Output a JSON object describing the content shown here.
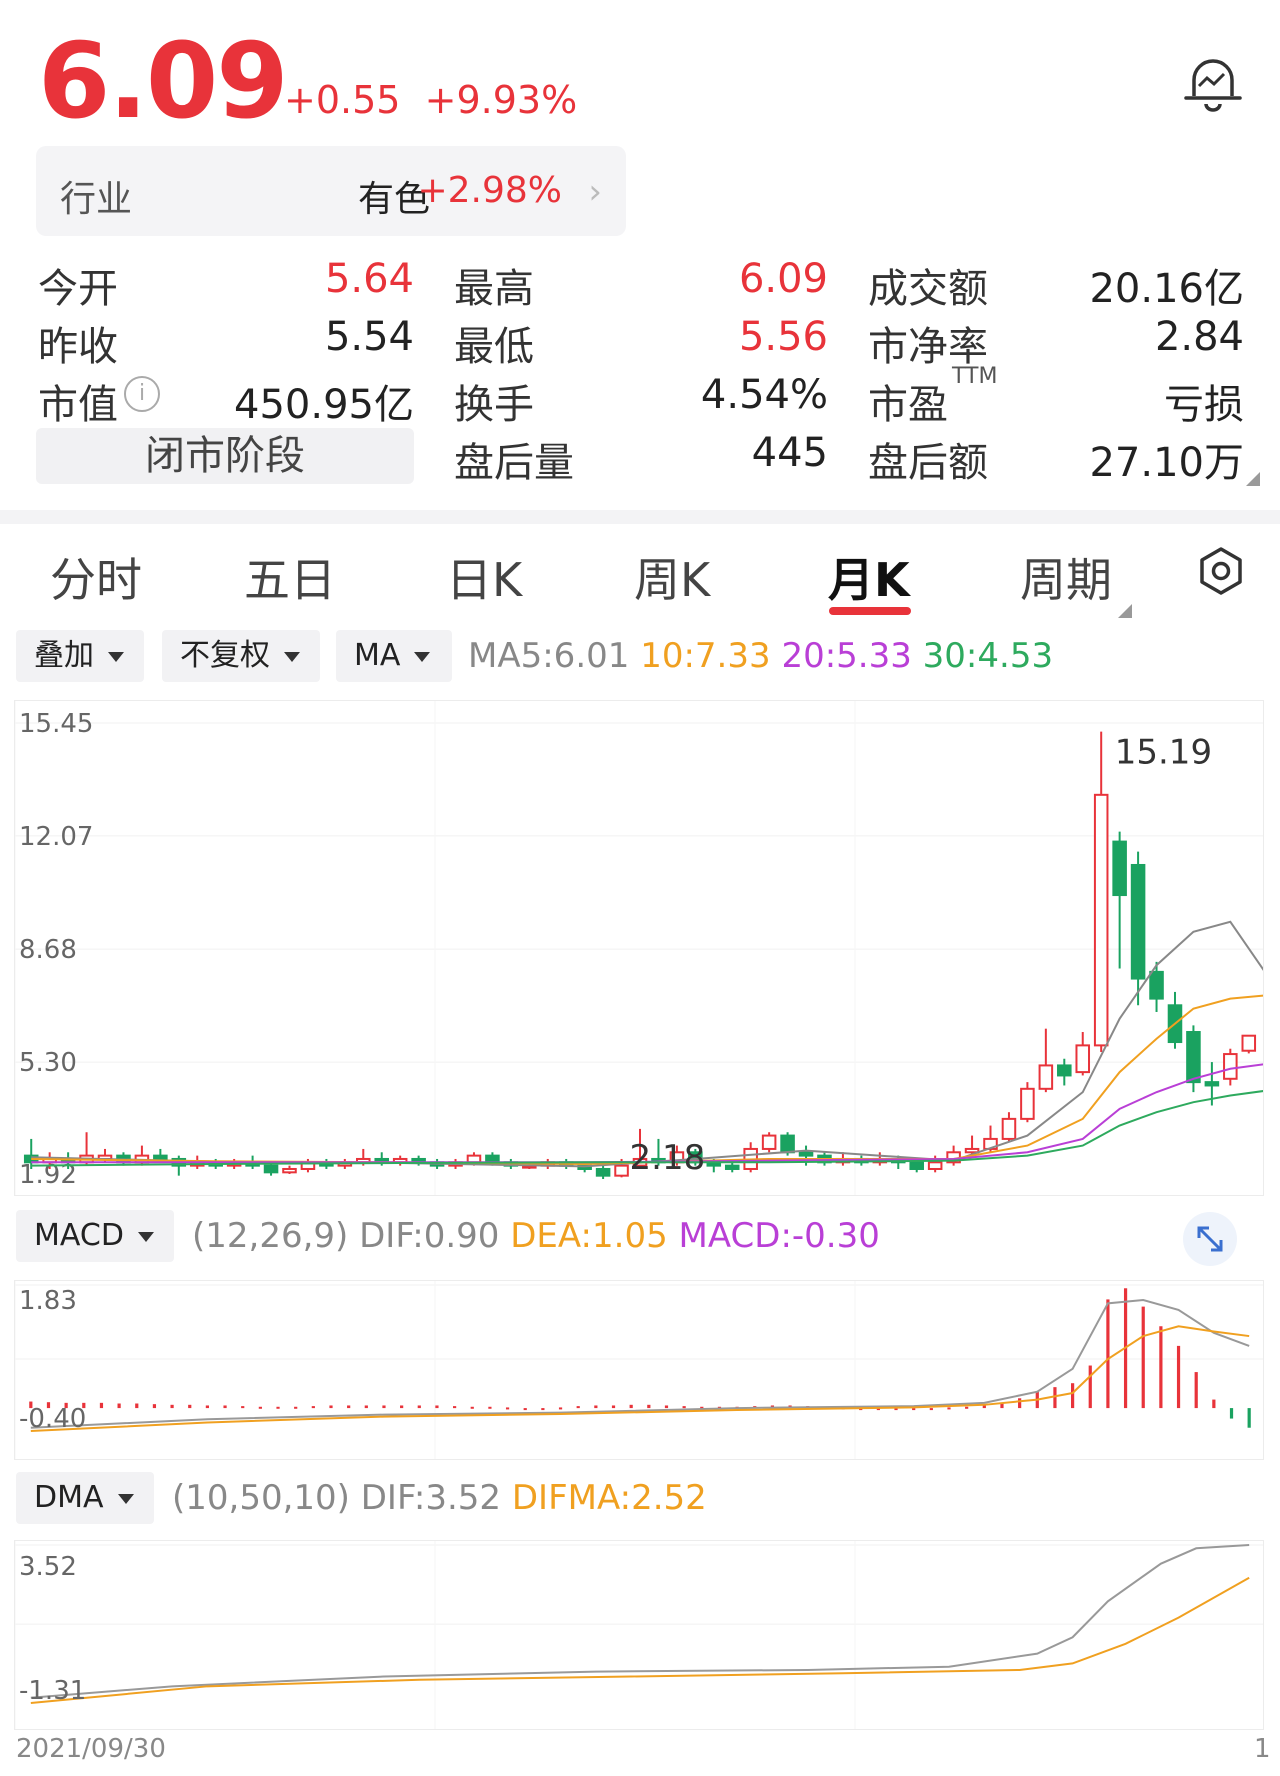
{
  "quote": {
    "price": "6.09",
    "change": "+0.55",
    "change_pct": "+9.93%",
    "industry_label": "行业",
    "industry_name": "有色",
    "industry_pct": "+2.98%",
    "status": "闭市阶段"
  },
  "stats": [
    {
      "label": "今开",
      "value": "5.64",
      "color": "#e8333a"
    },
    {
      "label": "最高",
      "value": "6.09",
      "color": "#e8333a"
    },
    {
      "label": "成交额",
      "value": "20.16亿",
      "color": "#222222"
    },
    {
      "label": "昨收",
      "value": "5.54",
      "color": "#222222"
    },
    {
      "label": "最低",
      "value": "5.56",
      "color": "#e8333a"
    },
    {
      "label": "市净率",
      "value": "2.84",
      "color": "#222222"
    },
    {
      "label": "市值",
      "value": "450.95亿",
      "color": "#222222"
    },
    {
      "label": "换手",
      "value": "4.54%",
      "color": "#222222"
    },
    {
      "label": "市盈",
      "sup": "TTM",
      "value": "亏损",
      "color": "#222222"
    },
    {
      "label": "盘后量",
      "value": "445",
      "color": "#222222"
    },
    {
      "label": "盘后额",
      "value": "27.10万",
      "color": "#222222"
    }
  ],
  "tabs": [
    "分时",
    "五日",
    "日K",
    "周K",
    "月K",
    "周期"
  ],
  "active_tab": "月K",
  "toolbar": {
    "overlay": "叠加",
    "adjust": "不复权",
    "indicator": "MA",
    "ma5": "MA5:6.01",
    "ma10": "10:7.33",
    "ma20": "20:5.33",
    "ma30": "30:4.53"
  },
  "macd_bar": {
    "name": "MACD",
    "params": "(12,26,9)",
    "dif": "DIF:0.90",
    "dea": "DEA:1.05",
    "macd": "MACD:-0.30"
  },
  "dma_bar": {
    "name": "DMA",
    "params": "(10,50,10)",
    "dif": "DIF:3.52",
    "difma": "DIFMA:2.52"
  },
  "dates": {
    "left": "2021/09/30",
    "right": "1"
  },
  "colors": {
    "up": "#e8333a",
    "down": "#1aa260",
    "ma5": "#888888",
    "ma10": "#f0a020",
    "ma20": "#b93fd6",
    "ma30": "#2eaa5e"
  },
  "chart_data": [
    {
      "type": "candlestick",
      "axis_labels": [
        "15.45",
        "12.07",
        "8.68",
        "5.30",
        "1.92"
      ],
      "ylim": [
        1.92,
        15.45
      ],
      "max_label": "15.19",
      "min_label": "2.18",
      "legend": [
        "MA5",
        "10",
        "20",
        "30"
      ],
      "candles": [
        {
          "o": 2.5,
          "c": 2.3,
          "h": 3.0,
          "l": 2.1
        },
        {
          "o": 2.3,
          "c": 2.4,
          "h": 2.6,
          "l": 2.1
        },
        {
          "o": 2.4,
          "c": 2.3,
          "h": 2.6,
          "l": 2.1
        },
        {
          "o": 2.3,
          "c": 2.5,
          "h": 3.2,
          "l": 2.2
        },
        {
          "o": 2.4,
          "c": 2.5,
          "h": 2.7,
          "l": 2.3
        },
        {
          "o": 2.5,
          "c": 2.3,
          "h": 2.6,
          "l": 2.2
        },
        {
          "o": 2.3,
          "c": 2.5,
          "h": 2.8,
          "l": 2.2
        },
        {
          "o": 2.5,
          "c": 2.4,
          "h": 2.7,
          "l": 2.3
        },
        {
          "o": 2.4,
          "c": 2.2,
          "h": 2.5,
          "l": 1.9
        },
        {
          "o": 2.2,
          "c": 2.3,
          "h": 2.5,
          "l": 2.1
        },
        {
          "o": 2.3,
          "c": 2.2,
          "h": 2.4,
          "l": 2.1
        },
        {
          "o": 2.2,
          "c": 2.3,
          "h": 2.4,
          "l": 2.1
        },
        {
          "o": 2.3,
          "c": 2.2,
          "h": 2.5,
          "l": 2.1
        },
        {
          "o": 2.2,
          "c": 2.0,
          "h": 2.3,
          "l": 1.9
        },
        {
          "o": 2.0,
          "c": 2.1,
          "h": 2.2,
          "l": 1.95
        },
        {
          "o": 2.1,
          "c": 2.3,
          "h": 2.4,
          "l": 2.0
        },
        {
          "o": 2.3,
          "c": 2.2,
          "h": 2.4,
          "l": 2.1
        },
        {
          "o": 2.2,
          "c": 2.3,
          "h": 2.4,
          "l": 2.1
        },
        {
          "o": 2.3,
          "c": 2.4,
          "h": 2.7,
          "l": 2.2
        },
        {
          "o": 2.4,
          "c": 2.3,
          "h": 2.6,
          "l": 2.2
        },
        {
          "o": 2.3,
          "c": 2.4,
          "h": 2.5,
          "l": 2.2
        },
        {
          "o": 2.4,
          "c": 2.3,
          "h": 2.5,
          "l": 2.2
        },
        {
          "o": 2.3,
          "c": 2.2,
          "h": 2.4,
          "l": 2.1
        },
        {
          "o": 2.2,
          "c": 2.3,
          "h": 2.4,
          "l": 2.1
        },
        {
          "o": 2.3,
          "c": 2.5,
          "h": 2.6,
          "l": 2.2
        },
        {
          "o": 2.5,
          "c": 2.3,
          "h": 2.6,
          "l": 2.2
        },
        {
          "o": 2.3,
          "c": 2.2,
          "h": 2.4,
          "l": 2.1
        },
        {
          "o": 2.2,
          "c": 2.2,
          "h": 2.3,
          "l": 2.1
        },
        {
          "o": 2.2,
          "c": 2.3,
          "h": 2.4,
          "l": 2.1
        },
        {
          "o": 2.3,
          "c": 2.2,
          "h": 2.4,
          "l": 2.1
        },
        {
          "o": 2.2,
          "c": 2.1,
          "h": 2.3,
          "l": 2.0
        },
        {
          "o": 2.1,
          "c": 1.9,
          "h": 2.2,
          "l": 1.8
        },
        {
          "o": 1.9,
          "c": 2.2,
          "h": 2.4,
          "l": 1.85
        },
        {
          "o": 2.2,
          "c": 2.4,
          "h": 3.3,
          "l": 2.1
        },
        {
          "o": 2.4,
          "c": 2.3,
          "h": 3.0,
          "l": 2.2
        },
        {
          "o": 2.3,
          "c": 2.6,
          "h": 2.8,
          "l": 2.2
        },
        {
          "o": 2.6,
          "c": 2.3,
          "h": 2.7,
          "l": 2.2
        },
        {
          "o": 2.3,
          "c": 2.2,
          "h": 2.4,
          "l": 2.0
        },
        {
          "o": 2.2,
          "c": 2.1,
          "h": 2.3,
          "l": 2.0
        },
        {
          "o": 2.1,
          "c": 2.7,
          "h": 2.9,
          "l": 2.0
        },
        {
          "o": 2.7,
          "c": 3.1,
          "h": 3.2,
          "l": 2.6
        },
        {
          "o": 3.1,
          "c": 2.6,
          "h": 3.2,
          "l": 2.5
        },
        {
          "o": 2.6,
          "c": 2.5,
          "h": 2.8,
          "l": 2.2
        },
        {
          "o": 2.5,
          "c": 2.3,
          "h": 2.6,
          "l": 2.2
        },
        {
          "o": 2.3,
          "c": 2.4,
          "h": 2.6,
          "l": 2.2
        },
        {
          "o": 2.4,
          "c": 2.3,
          "h": 2.5,
          "l": 2.2
        },
        {
          "o": 2.3,
          "c": 2.4,
          "h": 2.6,
          "l": 2.2
        },
        {
          "o": 2.4,
          "c": 2.3,
          "h": 2.5,
          "l": 2.1
        },
        {
          "o": 2.3,
          "c": 2.1,
          "h": 2.4,
          "l": 2.0
        },
        {
          "o": 2.1,
          "c": 2.3,
          "h": 2.5,
          "l": 2.0
        },
        {
          "o": 2.3,
          "c": 2.6,
          "h": 2.8,
          "l": 2.2
        },
        {
          "o": 2.6,
          "c": 2.7,
          "h": 3.1,
          "l": 2.5
        },
        {
          "o": 2.7,
          "c": 3.0,
          "h": 3.4,
          "l": 2.6
        },
        {
          "o": 3.0,
          "c": 3.6,
          "h": 3.8,
          "l": 2.9
        },
        {
          "o": 3.6,
          "c": 4.5,
          "h": 4.7,
          "l": 3.5
        },
        {
          "o": 4.5,
          "c": 5.2,
          "h": 6.3,
          "l": 4.4
        },
        {
          "o": 5.2,
          "c": 4.9,
          "h": 5.4,
          "l": 4.6
        },
        {
          "o": 5.0,
          "c": 5.8,
          "h": 6.2,
          "l": 4.9
        },
        {
          "o": 5.8,
          "c": 13.3,
          "h": 15.19,
          "l": 5.6
        },
        {
          "o": 11.9,
          "c": 10.3,
          "h": 12.2,
          "l": 8.1
        },
        {
          "o": 11.2,
          "c": 7.8,
          "h": 11.6,
          "l": 7.0
        },
        {
          "o": 8.0,
          "c": 7.2,
          "h": 8.3,
          "l": 6.8
        },
        {
          "o": 7.0,
          "c": 5.9,
          "h": 7.4,
          "l": 5.7
        },
        {
          "o": 6.2,
          "c": 4.7,
          "h": 6.4,
          "l": 4.4
        },
        {
          "o": 4.7,
          "c": 4.6,
          "h": 5.3,
          "l": 4.0
        },
        {
          "o": 4.8,
          "c": 5.54,
          "h": 5.7,
          "l": 4.6
        },
        {
          "o": 5.64,
          "c": 6.09,
          "h": 6.09,
          "l": 5.56
        }
      ],
      "ma_series": [
        {
          "name": "MA5",
          "values": [
            [
              0,
              2.45
            ],
            [
              10,
              2.32
            ],
            [
              20,
              2.28
            ],
            [
              30,
              2.18
            ],
            [
              36,
              2.4
            ],
            [
              42,
              2.65
            ],
            [
              50,
              2.35
            ],
            [
              54,
              3.1
            ],
            [
              57,
              4.4
            ],
            [
              59,
              6.6
            ],
            [
              61,
              8.2
            ],
            [
              63,
              9.2
            ],
            [
              65,
              9.5
            ],
            [
              67,
              7.9
            ],
            [
              69,
              6.01
            ]
          ]
        },
        {
          "name": "10",
          "values": [
            [
              0,
              2.4
            ],
            [
              10,
              2.33
            ],
            [
              20,
              2.3
            ],
            [
              30,
              2.25
            ],
            [
              40,
              2.4
            ],
            [
              50,
              2.4
            ],
            [
              54,
              2.8
            ],
            [
              57,
              3.6
            ],
            [
              59,
              5.0
            ],
            [
              61,
              6.0
            ],
            [
              63,
              6.9
            ],
            [
              65,
              7.2
            ],
            [
              67,
              7.3
            ],
            [
              69,
              7.33
            ]
          ]
        },
        {
          "name": "20",
          "values": [
            [
              0,
              2.3
            ],
            [
              10,
              2.3
            ],
            [
              20,
              2.3
            ],
            [
              30,
              2.3
            ],
            [
              40,
              2.35
            ],
            [
              50,
              2.4
            ],
            [
              54,
              2.6
            ],
            [
              57,
              3.0
            ],
            [
              59,
              3.9
            ],
            [
              61,
              4.4
            ],
            [
              63,
              4.8
            ],
            [
              65,
              5.1
            ],
            [
              67,
              5.25
            ],
            [
              69,
              5.33
            ]
          ]
        },
        {
          "name": "30",
          "values": [
            [
              0,
              2.2
            ],
            [
              10,
              2.25
            ],
            [
              20,
              2.28
            ],
            [
              30,
              2.3
            ],
            [
              40,
              2.3
            ],
            [
              50,
              2.35
            ],
            [
              54,
              2.5
            ],
            [
              57,
              2.8
            ],
            [
              59,
              3.4
            ],
            [
              61,
              3.8
            ],
            [
              63,
              4.1
            ],
            [
              65,
              4.3
            ],
            [
              67,
              4.45
            ],
            [
              69,
              4.53
            ]
          ]
        }
      ]
    },
    {
      "type": "bar",
      "axis_labels": [
        "1.83",
        "-0.40"
      ],
      "ylim": [
        -0.4,
        1.83
      ],
      "hist": [
        0.1,
        0.09,
        0.08,
        0.08,
        0.08,
        0.07,
        0.07,
        0.06,
        0.05,
        0.05,
        0.04,
        0.04,
        0.03,
        0.02,
        0.02,
        0.02,
        0.03,
        0.04,
        0.04,
        0.04,
        0.04,
        0.04,
        0.04,
        0.04,
        0.03,
        0.02,
        0.02,
        0.01,
        0.0,
        0.0,
        0.01,
        0.03,
        0.04,
        0.04,
        0.05,
        0.05,
        0.04,
        0.03,
        0.02,
        0.02,
        0.02,
        0.03,
        0.04,
        0.04,
        0.03,
        0.02,
        0.01,
        0.0,
        0.0,
        0.0,
        0.0,
        0.0,
        0.01,
        0.02,
        0.05,
        0.08,
        0.15,
        0.26,
        0.32,
        0.38,
        0.65,
        1.66,
        1.83,
        1.55,
        1.25,
        0.95,
        0.55,
        0.13,
        -0.16,
        -0.3
      ],
      "dif": [
        [
          0,
          -0.35
        ],
        [
          10,
          -0.22
        ],
        [
          20,
          -0.15
        ],
        [
          30,
          -0.12
        ],
        [
          40,
          -0.05
        ],
        [
          50,
          -0.02
        ],
        [
          54,
          0.03
        ],
        [
          57,
          0.2
        ],
        [
          59,
          0.55
        ],
        [
          61,
          1.55
        ],
        [
          63,
          1.6
        ],
        [
          65,
          1.45
        ],
        [
          67,
          1.1
        ],
        [
          69,
          0.9
        ]
      ],
      "dea": [
        [
          0,
          -0.4
        ],
        [
          10,
          -0.27
        ],
        [
          20,
          -0.18
        ],
        [
          30,
          -0.14
        ],
        [
          40,
          -0.08
        ],
        [
          50,
          -0.04
        ],
        [
          54,
          0.0
        ],
        [
          57,
          0.08
        ],
        [
          59,
          0.18
        ],
        [
          61,
          0.7
        ],
        [
          63,
          1.05
        ],
        [
          65,
          1.2
        ],
        [
          67,
          1.12
        ],
        [
          69,
          1.05
        ]
      ]
    },
    {
      "type": "line",
      "axis_labels": [
        "3.52",
        "-1.31"
      ],
      "ylim": [
        -1.31,
        3.52
      ],
      "series": [
        {
          "name": "DIF",
          "values": [
            [
              0,
              -1.15
            ],
            [
              8,
              -0.8
            ],
            [
              20,
              -0.5
            ],
            [
              32,
              -0.35
            ],
            [
              44,
              -0.3
            ],
            [
              52,
              -0.2
            ],
            [
              57,
              0.2
            ],
            [
              59,
              0.7
            ],
            [
              61,
              1.8
            ],
            [
              64,
              2.95
            ],
            [
              66,
              3.42
            ],
            [
              69,
              3.52
            ]
          ]
        },
        {
          "name": "DIFMA",
          "values": [
            [
              0,
              -1.31
            ],
            [
              10,
              -0.8
            ],
            [
              22,
              -0.6
            ],
            [
              34,
              -0.5
            ],
            [
              46,
              -0.4
            ],
            [
              56,
              -0.3
            ],
            [
              59,
              -0.1
            ],
            [
              62,
              0.5
            ],
            [
              65,
              1.3
            ],
            [
              69,
              2.52
            ]
          ]
        }
      ]
    }
  ]
}
